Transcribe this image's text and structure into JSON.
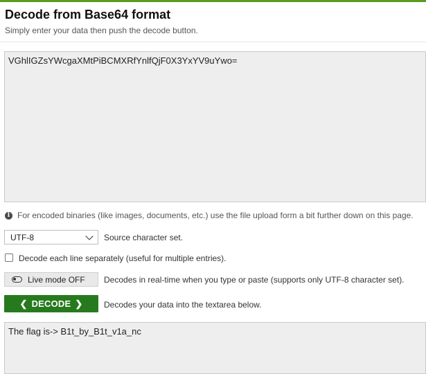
{
  "page": {
    "title": "Decode from Base64 format",
    "subtitle": "Simply enter your data then push the decode button."
  },
  "input": {
    "value": "VGhlIGZsYWcgaXMtPiBCMXRfYnlfQjF0X3YxYV9uYwo="
  },
  "info": {
    "text": "For encoded binaries (like images, documents, etc.) use the file upload form a bit further down on this page."
  },
  "charset": {
    "selected": "UTF-8",
    "label": "Source character set."
  },
  "each_line": {
    "label": "Decode each line separately (useful for multiple entries).",
    "checked": false
  },
  "live_mode": {
    "button_label": "Live mode OFF",
    "description": "Decodes in real-time when you type or paste (supports only UTF-8 character set)."
  },
  "decode": {
    "button_label": "DECODE",
    "description": "Decodes your data into the textarea below."
  },
  "output": {
    "value": "The flag is-> B1t_by_B1t_v1a_nc"
  },
  "colors": {
    "accent": "#267a1d",
    "top_bar": "#5a9a1f",
    "textarea_bg": "#eeeeee"
  }
}
